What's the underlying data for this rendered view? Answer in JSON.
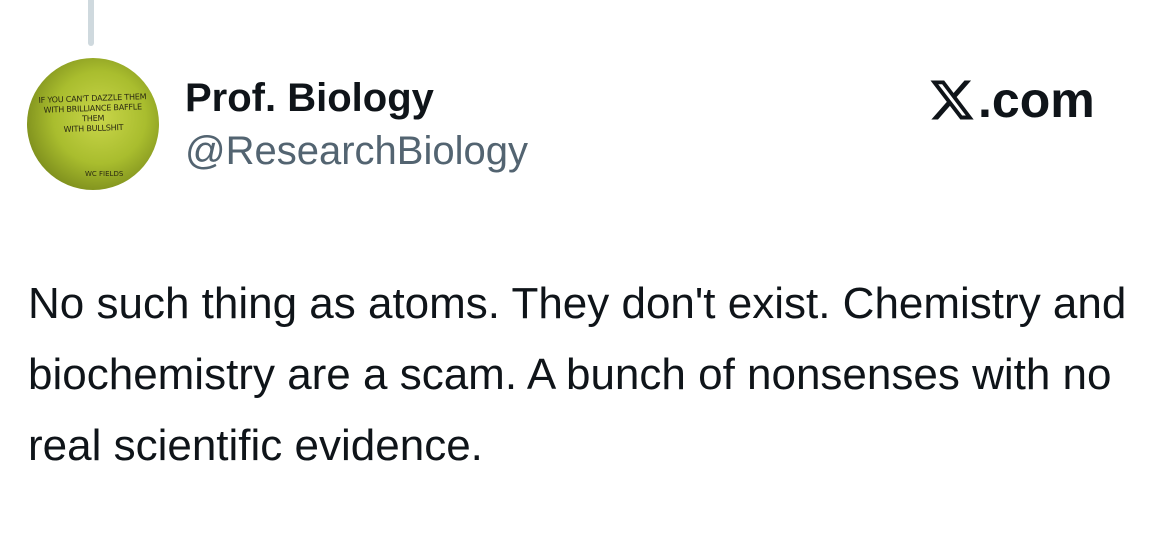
{
  "author": {
    "display_name": "Prof. Biology",
    "handle": "@ResearchBiology",
    "avatar": {
      "caption": "IF YOU CAN'T DAZZLE THEM\nWITH BRILLIANCE BAFFLE THEM\nWITH BULLSHIT",
      "signature": "WC FIELDS",
      "icon": "avatar-photo"
    }
  },
  "brand": {
    "label": ".com",
    "icon": "x-logo-icon"
  },
  "tweet": {
    "text": "No such thing as atoms. They don't exist. Chemistry and biochemistry are a scam. A bunch of nonsenses with no real scientific evidence."
  },
  "colors": {
    "text_primary": "#0f1419",
    "text_secondary": "#536471",
    "thread_line": "#cfd9de"
  }
}
